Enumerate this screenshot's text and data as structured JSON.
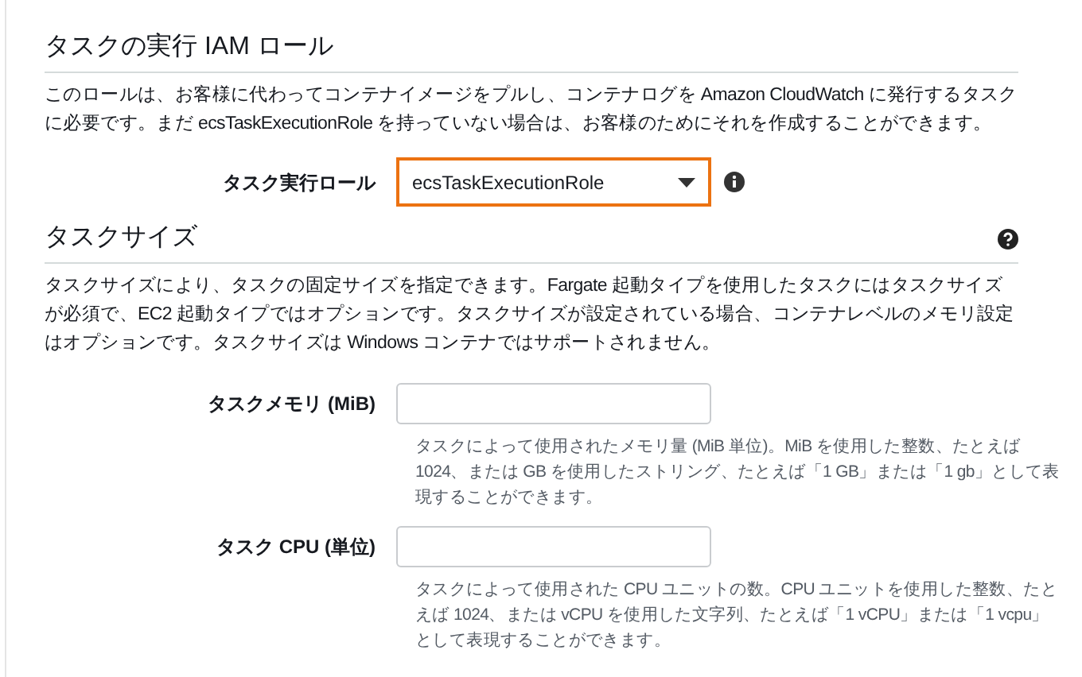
{
  "sections": [
    {
      "title": "タスクの実行 IAM ロール",
      "help_icon": false,
      "description": "このロールは、お客様に代わってコンテナイメージをプルし、コンテナログを Amazon CloudWatch に発行するタスクに必要です。まだ ecsTaskExecutionRole を持っていない場合は、お客様のためにそれを作成することができます。",
      "fields": [
        {
          "kind": "select",
          "label": "タスク実行ロール",
          "value": "ecsTaskExecutionRole",
          "focused": true,
          "info_icon": true
        }
      ]
    },
    {
      "title": "タスクサイズ",
      "help_icon": true,
      "description": "タスクサイズにより、タスクの固定サイズを指定できます。Fargate 起動タイプを使用したタスクにはタスクサイズが必須で、EC2 起動タイプではオプションです。タスクサイズが設定されている場合、コンテナレベルのメモリ設定はオプションです。タスクサイズは Windows コンテナではサポートされません。",
      "fields": [
        {
          "kind": "input",
          "label": "タスクメモリ (MiB)",
          "focused": false,
          "hint": "タスクによって使用されたメモリ量 (MiB 単位)。MiB を使用した整数、たとえば 1024、または GB を使用したストリング、たとえば「1 GB」または「1 gb」として表現することができます。"
        },
        {
          "kind": "input",
          "label": "タスク CPU (単位)",
          "focused": false,
          "hint": "タスクによって使用された CPU ユニットの数。CPU ユニットを使用した整数、たとえば 1024、または vCPU を使用した文字列、たとえば「1 vCPU」または「1 vcpu」として表現することができます。"
        }
      ]
    }
  ]
}
